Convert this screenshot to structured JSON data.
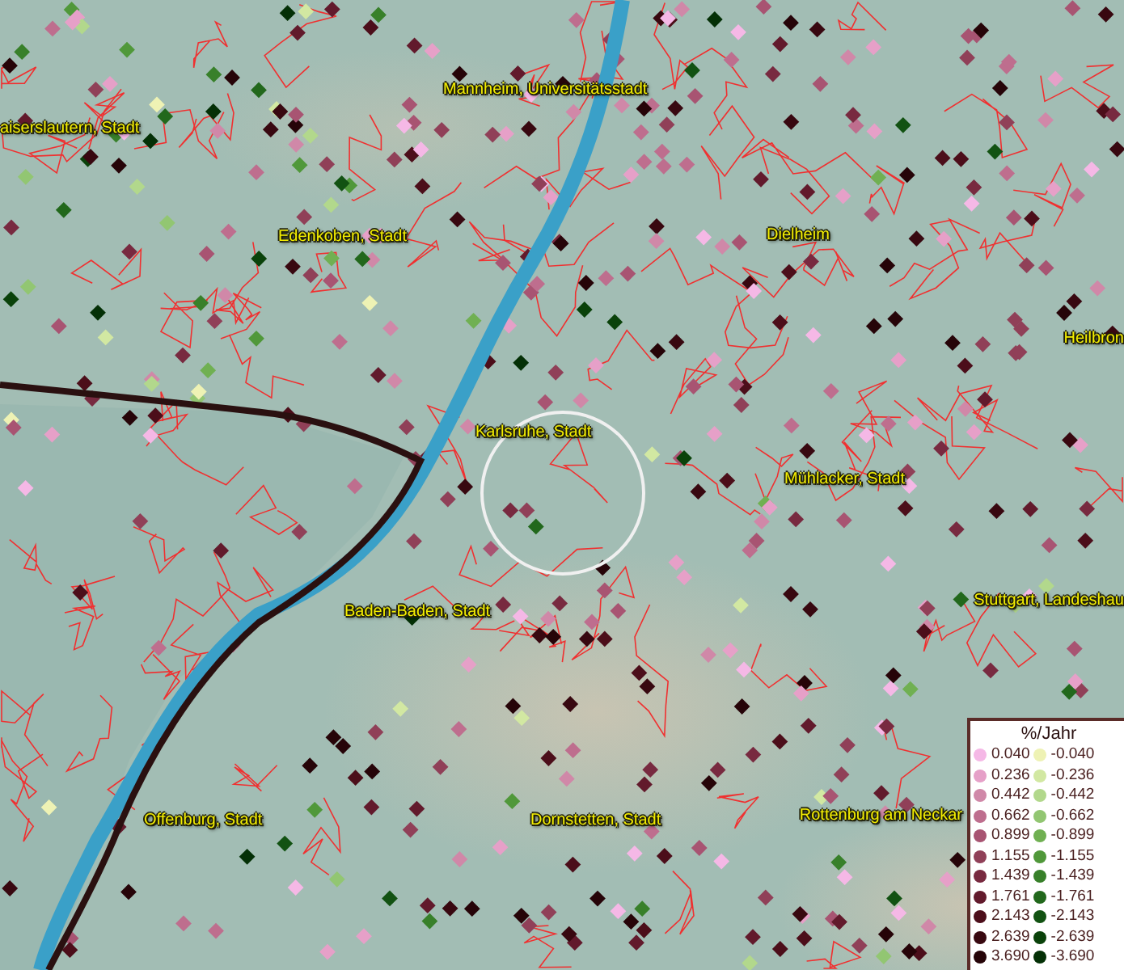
{
  "map": {
    "place_labels": [
      {
        "text": "aiserslautern, Stadt"
      },
      {
        "text": "Mannheim, Universitätsstadt"
      },
      {
        "text": "Edenkoben, Stadt"
      },
      {
        "text": "Dielheim"
      },
      {
        "text": "Heilbron"
      },
      {
        "text": "Karlsruhe, Stadt"
      },
      {
        "text": "Mühlacker, Stadt"
      },
      {
        "text": "Baden-Baden, Stadt"
      },
      {
        "text": "Stuttgart, Landeshau"
      },
      {
        "text": "Offenburg, Stadt"
      },
      {
        "text": "Dornstetten, Stadt"
      },
      {
        "text": "Rottenburg am Neckar"
      }
    ]
  },
  "legend": {
    "title": "%/Jahr",
    "columns": [
      {
        "items": [
          {
            "label": "0.040",
            "color": "#f5b8e6"
          },
          {
            "label": "0.236",
            "color": "#e6a0c8"
          },
          {
            "label": "0.442",
            "color": "#d088a8"
          },
          {
            "label": "0.662",
            "color": "#be6e8e"
          },
          {
            "label": "0.899",
            "color": "#a85472"
          },
          {
            "label": "1.155",
            "color": "#904058"
          },
          {
            "label": "1.439",
            "color": "#782a40"
          },
          {
            "label": "1.761",
            "color": "#621a2c"
          },
          {
            "label": "2.143",
            "color": "#4c0e1a"
          },
          {
            "label": "2.639",
            "color": "#380810"
          },
          {
            "label": "3.690",
            "color": "#260408"
          }
        ]
      },
      {
        "items": [
          {
            "label": "-0.040",
            "color": "#eef2b4"
          },
          {
            "label": "-0.236",
            "color": "#d2e8a2"
          },
          {
            "label": "-0.442",
            "color": "#b2d88c"
          },
          {
            "label": "-0.662",
            "color": "#92c672"
          },
          {
            "label": "-0.899",
            "color": "#70b052"
          },
          {
            "label": "-1.155",
            "color": "#50983a"
          },
          {
            "label": "-1.439",
            "color": "#38802a"
          },
          {
            "label": "-1.761",
            "color": "#22681c"
          },
          {
            "label": "-2.143",
            "color": "#125212"
          },
          {
            "label": "-2.639",
            "color": "#0a420a"
          },
          {
            "label": "-3.690",
            "color": "#043006"
          }
        ]
      }
    ]
  }
}
